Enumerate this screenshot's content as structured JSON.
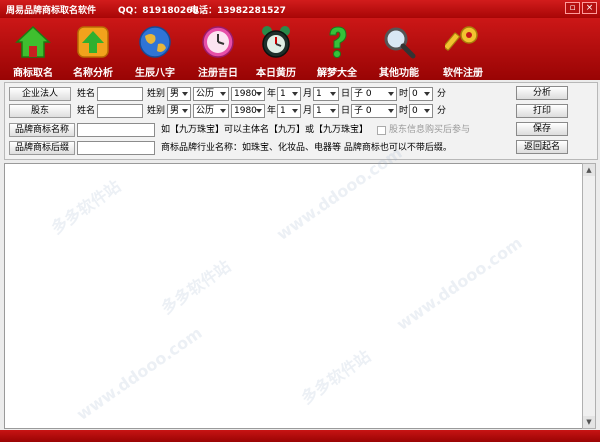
{
  "window": {
    "title": "周易品牌商标取名软件",
    "qq": "QQ：819180265",
    "phone": "电话：13982281527",
    "controls": {
      "minimize": "▫",
      "close": "×"
    }
  },
  "toolbar": {
    "items": [
      {
        "label": "商标取名",
        "icon": "house-icon"
      },
      {
        "label": "名称分析",
        "icon": "up-arrow-icon"
      },
      {
        "label": "生辰八字",
        "icon": "globe-icon"
      },
      {
        "label": "注册吉日",
        "icon": "clock-icon"
      },
      {
        "label": "本日黄历",
        "icon": "alarm-clock-icon"
      },
      {
        "label": "解梦大全",
        "icon": "question-icon"
      },
      {
        "label": "其他功能",
        "icon": "magnifier-icon"
      },
      {
        "label": "软件注册",
        "icon": "key-icon"
      }
    ]
  },
  "form": {
    "rows": [
      {
        "role": "企业法人",
        "name_label": "姓名",
        "name_value": "",
        "gender_label": "姓别",
        "gender": "男",
        "calendar": "公历",
        "year": "1980",
        "year_unit": "年",
        "month": "1",
        "month_unit": "月",
        "day": "1",
        "day_unit": "日",
        "hour": "子 0",
        "hour_unit": "时",
        "minute": "0",
        "minute_unit": "分"
      },
      {
        "role": "股东",
        "name_label": "姓名",
        "name_value": "",
        "gender_label": "姓别",
        "gender": "男",
        "calendar": "公历",
        "year": "1980",
        "year_unit": "年",
        "month": "1",
        "month_unit": "月",
        "day": "1",
        "day_unit": "日",
        "hour": "子 0",
        "hour_unit": "时",
        "minute": "0",
        "minute_unit": "分"
      }
    ],
    "brand_name_label": "品牌商标名称",
    "brand_name_value": "",
    "brand_name_hint": "如【九万珠宝】可以主体名【九万】或【九万珠宝】",
    "shareholder_checkbox_label": "股东信息购买后参与",
    "brand_suffix_label": "品牌商标后缀",
    "brand_suffix_value": "",
    "brand_suffix_hint": "商标品牌行业名称：如珠宝、化妆品、电器等 品牌商标也可以不带后缀。"
  },
  "actions": {
    "analyze": "分析",
    "print": "打印",
    "save": "保存",
    "back": "返回起名"
  },
  "watermark": "多多软件站",
  "watermark_url": "www.ddooo.com",
  "colors": {
    "accent": "#b50a0a",
    "toolbar_text": "#ffffff"
  }
}
